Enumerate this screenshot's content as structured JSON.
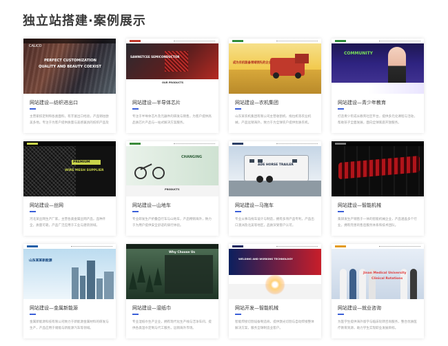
{
  "page": {
    "title": "独立站搭建·案例展示",
    "accent_color": "#3a5fd8"
  },
  "cards": [
    {
      "title": "网站建设—纺织进出口",
      "description": "主营家纺定制和各类面料，有丰富出口经验，产品销往欧美多地。专注于为客户提供质量与美感兼具的纺织产品及服务。",
      "thumb": {
        "logo": "CALICO",
        "line1": "PERFECT CUSTOMIZATION",
        "line2": "QUALITY AND BEAUTY COEXIST"
      }
    },
    {
      "title": "网站建设—半导体芯片",
      "description": "专注于半导体芯片及元器件的研发与销售，为客户提供高品质芯片产品与一站式解决方案服务。",
      "thumb": {
        "logo": "SAWNETCEE SEMICONDUCTOR",
        "line1": "OUR PRODUCTS"
      }
    },
    {
      "title": "网站建设—农机集团",
      "description": "山东某农机集团有限公司主营收割机、拖拉机等农业机械，产品远销海外，致力于为全球农户提供优质农机。",
      "thumb": {
        "line1": "成为农机装备领域领先的企业"
      }
    },
    {
      "title": "网站建设—青少年教育",
      "description": "打造青少年成长教育社区平台，提供多元化课程与活动，帮助孩子全面发展，面向全球家庭开放服务。",
      "thumb": {
        "line1": "COMMUNITY"
      }
    },
    {
      "title": "网站建设—丝网",
      "description": "河北某丝网生产厂家，主营各类金属丝网产品，品种齐全，质量可靠，产品广泛应用于工业与建筑领域。",
      "thumb": {
        "line1": "PREMIUM",
        "line2": "WIRE MESH SUPPLIER"
      }
    },
    {
      "title": "网站建设—山地车",
      "description": "专业研发生产折叠自行车与山地车，产品畅销海外，致力于为用户提供安全舒适的骑行体验。",
      "thumb": {
        "line1": "CHANGING",
        "line2": "PRODUCTS"
      }
    },
    {
      "title": "网站建设—马拖车",
      "description": "专业从事马拖车设计与制造，拥有多项产品专利，产品出口澳洲及北美等地区，品质深受客户认可。",
      "thumb": {
        "line1": "ADE HORSE TRAILER"
      }
    },
    {
      "title": "网站建设—智能机械",
      "description": "集研发生产销售于一体的智能机械企业，产品涵盖多个行业，拥有完善的售后服务体系和技术团队。",
      "thumb": {
        "line1": ""
      }
    },
    {
      "title": "网站建设—金属新能源",
      "description": "金属新能源科技有限公司致力于新能源金属材料的研发与生产，产品应用于储能与新能源汽车等领域。",
      "thumb": {
        "line1": "山东某某新能源"
      }
    },
    {
      "title": "网站建设—湿纸巾",
      "description": "专业湿纸巾生产企业，拥有现代化生产线与洁净车间，提供各类湿巾定制与代工服务，远销海外市场。",
      "thumb": {
        "line1": "Why Choose Us"
      }
    },
    {
      "title": "网站开发—智能机械",
      "description": "智能焊接切割设备制造商，提供激光切割与自动焊接整体解决方案，服务全球制造业客户。",
      "thumb": {
        "line1": "WELDING AND WORKING TECHNOLOGY"
      }
    },
    {
      "title": "网站建设—就业咨询",
      "description": "为医学生提供海外留学与临床轮转咨询服务，整合优质医疗教育资源，助力学生实现职业发展目标。",
      "thumb": {
        "line1": "Jinan Medical University",
        "line2": "Clinical Rotations"
      }
    }
  ]
}
